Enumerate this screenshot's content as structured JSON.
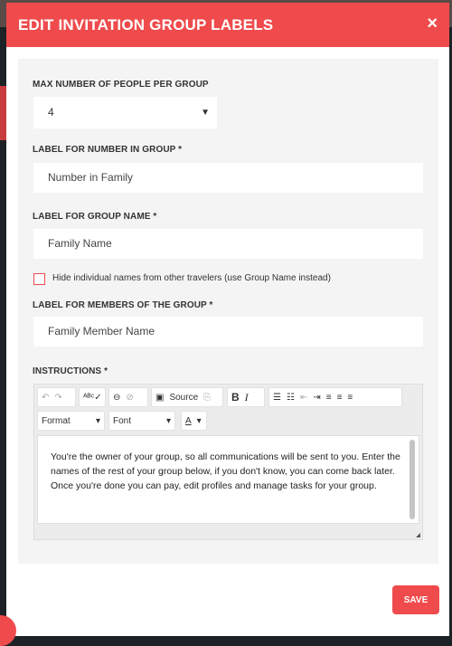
{
  "modal": {
    "title": "EDIT INVITATION GROUP LABELS",
    "close_icon": "×"
  },
  "fields": {
    "max_people": {
      "label": "MAX NUMBER OF PEOPLE PER GROUP",
      "value": "4"
    },
    "number_label": {
      "label": "LABEL FOR NUMBER IN GROUP *",
      "value": "Number in Family"
    },
    "group_name": {
      "label": "LABEL FOR GROUP NAME *",
      "value": "Family Name"
    },
    "hide_names": {
      "label": "Hide individual names from other travelers (use Group Name instead)",
      "checked": false
    },
    "members_label": {
      "label": "LABEL FOR MEMBERS OF THE GROUP *",
      "value": "Family Member Name"
    },
    "instructions": {
      "label": "INSTRUCTIONS *",
      "value": "You're the owner of your group, so all communications will be sent to you. Enter the names of the rest of your group below, if you don't know, you can come back later. Once you're done you can pay, edit profiles and manage tasks for your group."
    }
  },
  "toolbar": {
    "source": "Source",
    "bold": "B",
    "italic": "I",
    "format": "Format",
    "font": "Font",
    "color": "A"
  },
  "save_label": "SAVE",
  "colors": {
    "accent": "#ef4b4d",
    "panel": "#f4f4f4"
  }
}
